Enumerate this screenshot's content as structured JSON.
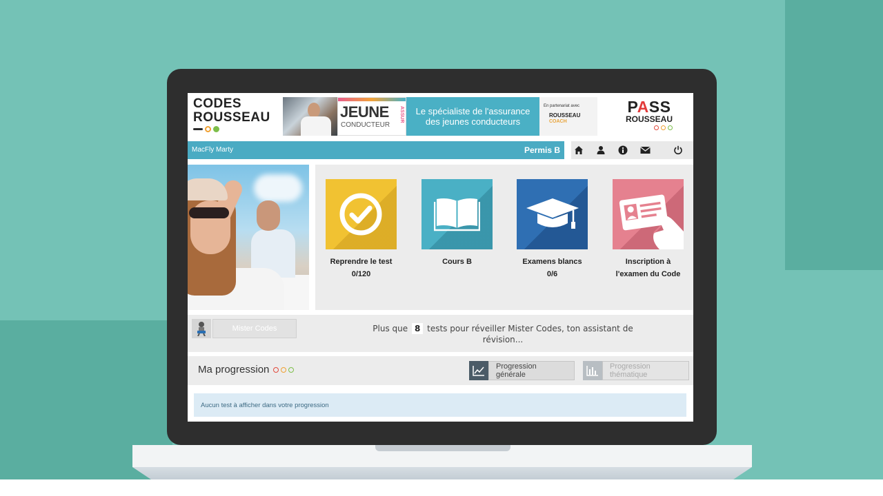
{
  "colors": {
    "background": "#74c2b6",
    "accent_blue": "#4aabc3",
    "tile_yellow": "#f1c232",
    "tile_teal": "#4ab0c5",
    "tile_blue": "#2f6fb3",
    "tile_pink": "#e5818f",
    "dot_red": "#e2493b",
    "dot_orange": "#f0a030",
    "dot_green": "#7dbe4a"
  },
  "header": {
    "logo_line1": "CODES",
    "logo_line2": "ROUSSEAU",
    "banner": {
      "jeune": "JEUNE",
      "conducteur": "CONDUCTEUR",
      "assur": "ASSUR",
      "tagline_line1": "Le spécialiste de l'assurance",
      "tagline_line2": "des jeunes conducteurs",
      "partner_line1": "En partenariat avec",
      "partner_line2": "ROUSSEAU",
      "partner_line3": "COACH"
    },
    "pass_p": "P",
    "pass_a": "A",
    "pass_ss": "SS",
    "pass_line2": "ROUSSEAU"
  },
  "userbar": {
    "user_name": "MacFly Marty",
    "permis": "Permis B"
  },
  "nav": {
    "icons": [
      "home-icon",
      "user-icon",
      "info-icon",
      "mail-icon",
      "power-icon"
    ]
  },
  "tiles": [
    {
      "label": "Reprendre le test",
      "sub": "0/120",
      "icon": "check-circle-icon"
    },
    {
      "label": "Cours B",
      "sub": "",
      "icon": "book-icon"
    },
    {
      "label": "Examens blancs",
      "sub": "0/6",
      "icon": "graduation-cap-icon"
    },
    {
      "label": "Inscription à",
      "sub": "l'examen du Code",
      "icon": "id-card-icon"
    }
  ],
  "mister": {
    "button_label": "Mister Codes",
    "message_prefix": "Plus que",
    "count": "8",
    "message_suffix": "tests pour réveiller Mister Codes, ton assistant de",
    "message_line2": "révision..."
  },
  "progression": {
    "title": "Ma progression",
    "button_general": "Progression générale",
    "button_thematic": "Progression thématique",
    "empty_message": "Aucun test à afficher dans votre progression"
  }
}
